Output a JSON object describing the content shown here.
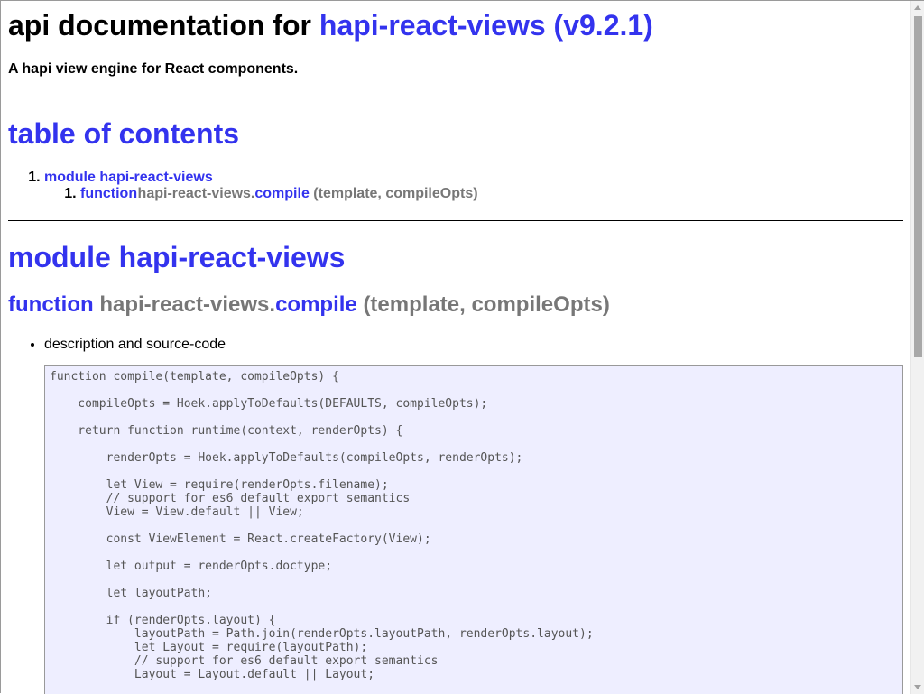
{
  "header": {
    "title_prefix": "api documentation for",
    "title_link": "hapi-react-views (v9.2.1)",
    "tagline": "A hapi view engine for React components."
  },
  "toc": {
    "title": "table of contents",
    "module_link": "module hapi-react-views",
    "fn_keyword": "function",
    "fn_prefix": "hapi-react-views.",
    "fn_name": "compile",
    "fn_args": "(template, compileOpts)"
  },
  "module": {
    "title": "module hapi-react-views",
    "fn_keyword": "function",
    "fn_prefix": "hapi-react-views.",
    "fn_name": "compile",
    "fn_args": "(template, compileOpts)",
    "desc_item": "description and source-code",
    "source_code": "function compile(template, compileOpts) {\n\n    compileOpts = Hoek.applyToDefaults(DEFAULTS, compileOpts);\n\n    return function runtime(context, renderOpts) {\n\n        renderOpts = Hoek.applyToDefaults(compileOpts, renderOpts);\n\n        let View = require(renderOpts.filename);\n        // support for es6 default export semantics\n        View = View.default || View;\n\n        const ViewElement = React.createFactory(View);\n\n        let output = renderOpts.doctype;\n\n        let layoutPath;\n\n        if (renderOpts.layout) {\n            layoutPath = Path.join(renderOpts.layoutPath, renderOpts.layout);\n            let Layout = require(layoutPath);\n            // support for es6 default export semantics\n            Layout = Layout.default || Layout;"
  }
}
